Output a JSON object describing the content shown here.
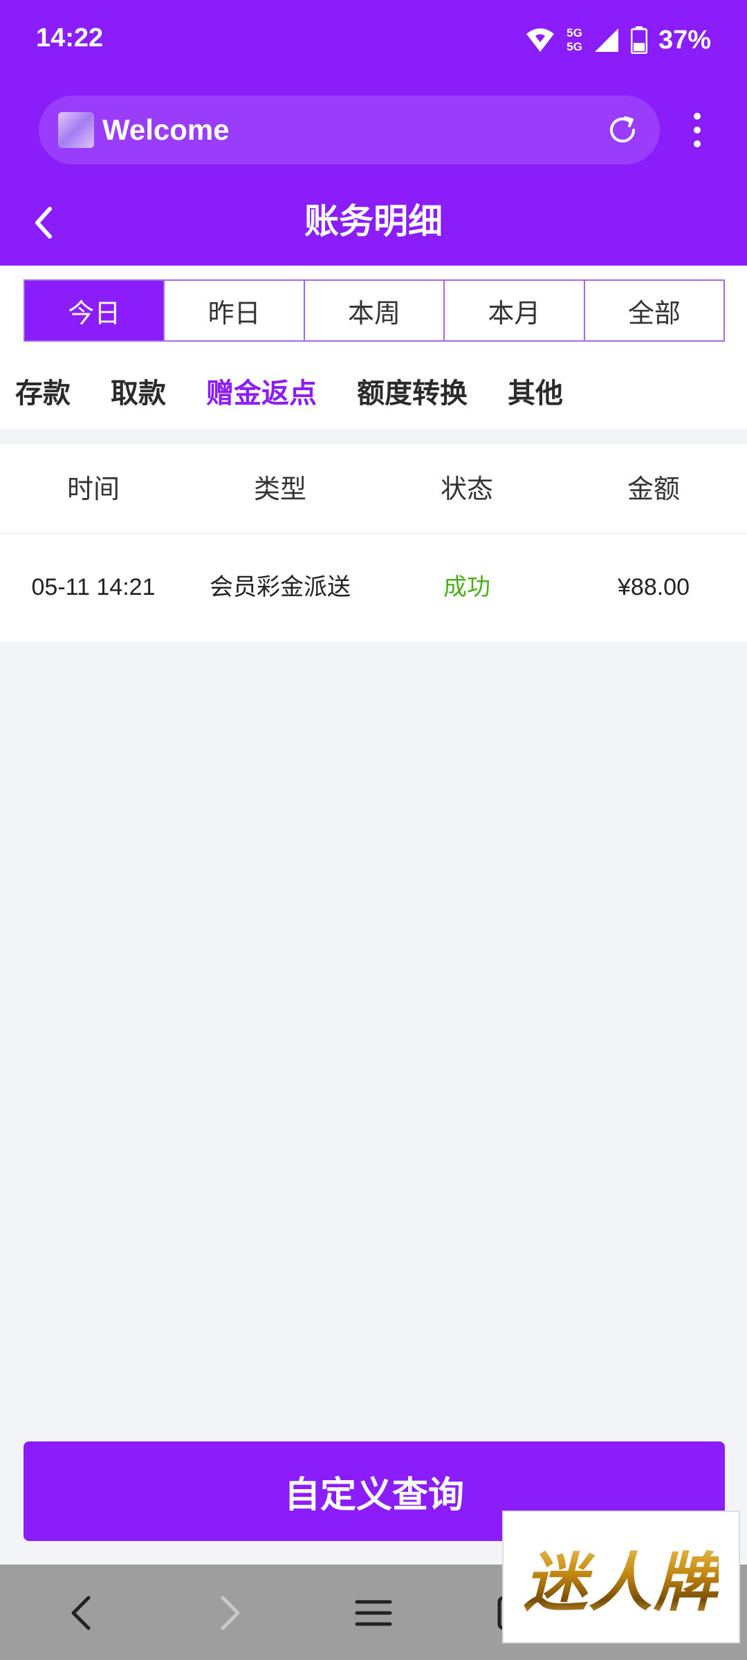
{
  "status_bar": {
    "time": "14:22",
    "network": [
      "5G",
      "5G"
    ],
    "battery": "37%"
  },
  "browser": {
    "tab_title": "Welcome"
  },
  "page": {
    "title": "账务明细"
  },
  "date_tabs": [
    {
      "label": "今日",
      "active": true
    },
    {
      "label": "昨日",
      "active": false
    },
    {
      "label": "本周",
      "active": false
    },
    {
      "label": "本月",
      "active": false
    },
    {
      "label": "全部",
      "active": false
    }
  ],
  "category_tabs": [
    {
      "label": "存款",
      "active": false
    },
    {
      "label": "取款",
      "active": false
    },
    {
      "label": "赠金返点",
      "active": true
    },
    {
      "label": "额度转换",
      "active": false
    },
    {
      "label": "其他",
      "active": false
    }
  ],
  "table": {
    "headers": [
      "时间",
      "类型",
      "状态",
      "金额"
    ],
    "rows": [
      {
        "time": "05-11 14:21",
        "type": "会员彩金派送",
        "status": "成功",
        "amount": "¥88.00"
      }
    ]
  },
  "query_button": {
    "label": "自定义查询"
  },
  "watermark": {
    "text": "迷人牌"
  },
  "colors": {
    "primary": "#8a1dfa",
    "success": "#4caf1a",
    "background": "#f3f4f7"
  }
}
